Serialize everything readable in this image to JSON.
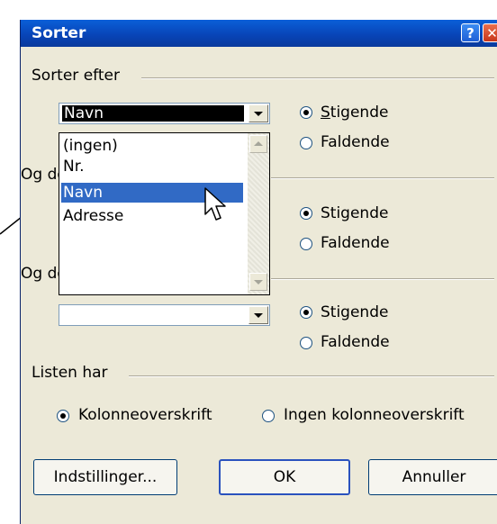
{
  "window": {
    "title": "Sorter"
  },
  "sort_by": {
    "legend": "Sorter efter",
    "combo_value": "Navn",
    "ascending_label": "Stigende",
    "descending_label": "Faldende",
    "ascending_selected": true
  },
  "dropdown": {
    "items": [
      "(ingen)",
      "Nr.",
      "Navn",
      "Adresse"
    ],
    "highlighted": "Navn"
  },
  "then_by": {
    "legend": "Og derefter",
    "combo_value": "",
    "ascending_label": "Stigende",
    "descending_label": "Faldende",
    "ascending_selected": true
  },
  "then_by_2": {
    "legend": "Og derefter",
    "combo_value": "",
    "ascending_label": "Stigende",
    "descending_label": "Faldende",
    "ascending_selected": true
  },
  "list_has": {
    "legend": "Listen har",
    "header_row_label": "Kolonneoverskrift",
    "no_header_row_label": "Ingen kolonneoverskrift",
    "header_row_selected": true
  },
  "buttons": {
    "options": "Indstillinger...",
    "ok": "OK",
    "cancel": "Annuller"
  },
  "colors": {
    "titlebar": "#0a4fc8",
    "highlight": "#316ac5",
    "dialog_bg": "#ece9d8"
  }
}
